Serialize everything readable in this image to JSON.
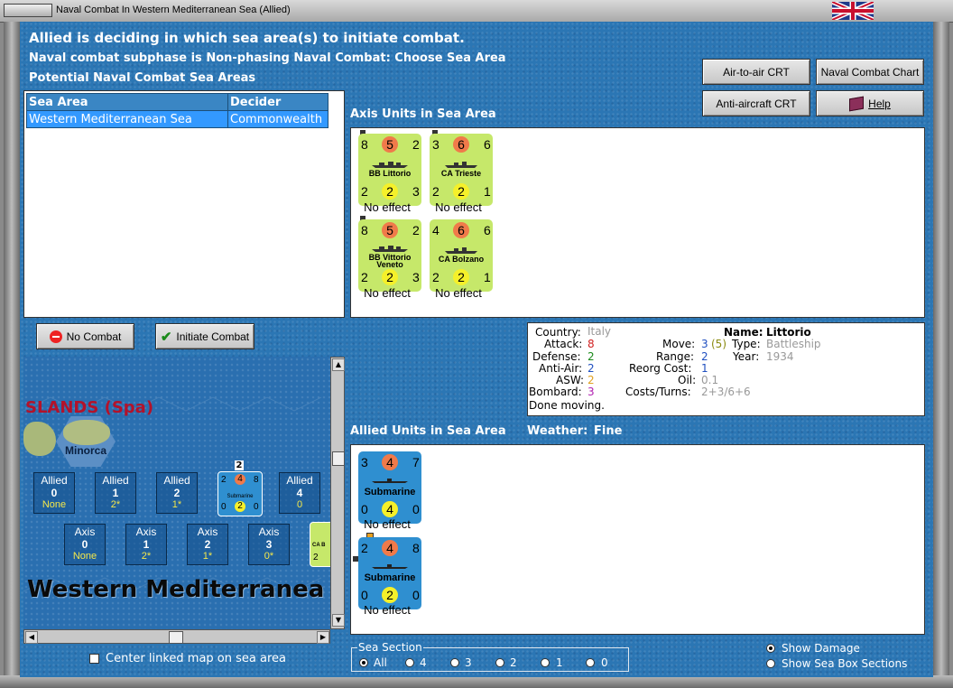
{
  "window": {
    "title": "Naval Combat In Western Mediterranean Sea (Allied)"
  },
  "header": {
    "line1": "Allied is deciding in which sea area(s) to initiate combat.",
    "line2": "Naval combat subphase is Non-phasing Naval Combat: Choose Sea Area",
    "line3": "Potential Naval Combat Sea Areas"
  },
  "buttons": {
    "air_to_air": "Air-to-air CRT",
    "naval_chart": "Naval Combat Chart",
    "anti_aircraft": "Anti-aircraft CRT",
    "help": "Help",
    "no_combat": "No Combat",
    "initiate_combat": "Initiate Combat"
  },
  "sea_table": {
    "headers": [
      "Sea Area",
      "Decider"
    ],
    "rows": [
      {
        "area": "Western Mediterranean Sea",
        "decider": "Commonwealth"
      }
    ]
  },
  "axis_section": {
    "title": "Axis Units in Sea Area"
  },
  "axis_units": [
    {
      "name": "BB Littorio",
      "tl": "8",
      "tc": "5",
      "tr": "2",
      "bl": "2",
      "bc": "2",
      "br": "3",
      "effect": "No effect"
    },
    {
      "name": "CA Trieste",
      "tl": "3",
      "tc": "6",
      "tr": "6",
      "bl": "2",
      "bc": "2",
      "br": "1",
      "effect": "No effect"
    },
    {
      "name": "BB Vittorio Veneto",
      "name1": "BB Vittorio",
      "name2": "Veneto",
      "tl": "8",
      "tc": "5",
      "tr": "2",
      "bl": "2",
      "bc": "2",
      "br": "3",
      "effect": "No effect"
    },
    {
      "name": "CA Bolzano",
      "tl": "4",
      "tc": "6",
      "tr": "6",
      "bl": "2",
      "bc": "2",
      "br": "1",
      "effect": "No effect"
    }
  ],
  "unit_info": {
    "country_label": "Country:",
    "country": "Italy",
    "attack_label": "Attack:",
    "attack": "8",
    "defense_label": "Defense:",
    "defense": "2",
    "antiair_label": "Anti-Air:",
    "antiair": "2",
    "asw_label": "ASW:",
    "asw": "2",
    "bombard_label": "Bombard:",
    "bombard": "3",
    "status": "Done moving.",
    "name_label": "Name:",
    "name": "Littorio",
    "move_label": "Move:",
    "move": "3",
    "move_extra": "(5)",
    "type_label": "Type:",
    "type": "Battleship",
    "range_label": "Range:",
    "range": "2",
    "year_label": "Year:",
    "year": "1934",
    "reorg_label": "Reorg Cost:",
    "reorg": "1",
    "oil_label": "Oil:",
    "oil": "0.1",
    "costs_label": "Costs/Turns:",
    "costs": "2+3/6+6"
  },
  "allied_section": {
    "title": "Allied Units in Sea Area",
    "weather_label": "Weather:",
    "weather": "Fine"
  },
  "allied_units": [
    {
      "name": "Submarine",
      "tl": "3",
      "tc": "4",
      "tr": "7",
      "bl": "0",
      "bc": "4",
      "br": "0",
      "effect": "No effect"
    },
    {
      "name": "Submarine",
      "tl": "2",
      "tc": "4",
      "tr": "8",
      "bl": "0",
      "bc": "2",
      "br": "0",
      "effect": "No effect"
    }
  ],
  "map": {
    "island_group": "SLANDS (Spa)",
    "island": "Minorca",
    "sea_name": "Western Mediterranea",
    "allied_boxes": [
      {
        "label": "Allied",
        "num": "0",
        "sub": "None"
      },
      {
        "label": "Allied",
        "num": "1",
        "sub": "2*"
      },
      {
        "label": "Allied",
        "num": "2",
        "sub": "1*"
      },
      {
        "label": "Allied",
        "num": "4",
        "sub": "0"
      }
    ],
    "axis_boxes": [
      {
        "label": "Axis",
        "num": "0",
        "sub": "None"
      },
      {
        "label": "Axis",
        "num": "1",
        "sub": "2*"
      },
      {
        "label": "Axis",
        "num": "2",
        "sub": "1*"
      },
      {
        "label": "Axis",
        "num": "3",
        "sub": "0*"
      }
    ],
    "stack_count": "2",
    "mini_sub": {
      "tl": "2",
      "tc": "4",
      "tr": "8",
      "name": "Submarine",
      "bl": "0",
      "bc": "2",
      "br": "0"
    },
    "mini_axis": {
      "name": "CA B",
      "bl": "2"
    }
  },
  "center_map": {
    "label": "Center linked map on sea area"
  },
  "sea_section": {
    "title": "Sea Section",
    "options": [
      "All",
      "4",
      "3",
      "2",
      "1",
      "0"
    ]
  },
  "display_options": {
    "show_damage": "Show Damage",
    "show_sections": "Show Sea Box Sections"
  },
  "colors": {
    "axis_counter": "#c6e86a",
    "allied_counter": "#2f8fd0",
    "selected_row": "#3399ff",
    "header_text": "#ffffff"
  }
}
